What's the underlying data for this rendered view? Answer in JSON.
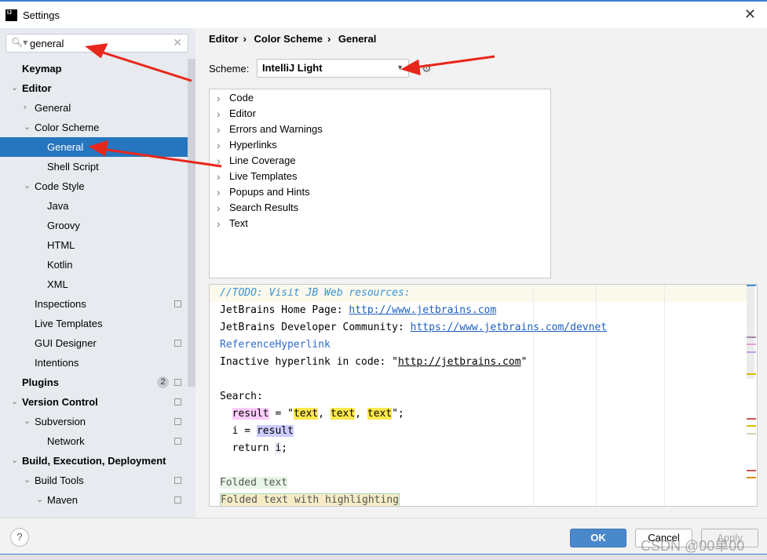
{
  "window": {
    "title": "Settings",
    "logo": "IJ"
  },
  "search": {
    "value": "general"
  },
  "sidebar": {
    "items": [
      {
        "label": "Keymap",
        "level": 0,
        "bold": true,
        "arrow": ""
      },
      {
        "label": "Editor",
        "level": 0,
        "bold": true,
        "arrow": "down"
      },
      {
        "label": "General",
        "level": 1,
        "arrow": "right"
      },
      {
        "label": "Color Scheme",
        "level": 1,
        "arrow": "down"
      },
      {
        "label": "General",
        "level": 2,
        "arrow": "",
        "selected": true
      },
      {
        "label": "Shell Script",
        "level": 2,
        "arrow": ""
      },
      {
        "label": "Code Style",
        "level": 1,
        "arrow": "down"
      },
      {
        "label": "Java",
        "level": 2,
        "arrow": ""
      },
      {
        "label": "Groovy",
        "level": 2,
        "arrow": ""
      },
      {
        "label": "HTML",
        "level": 2,
        "arrow": ""
      },
      {
        "label": "Kotlin",
        "level": 2,
        "arrow": ""
      },
      {
        "label": "XML",
        "level": 2,
        "arrow": ""
      },
      {
        "label": "Inspections",
        "level": 1,
        "arrow": "",
        "page": true
      },
      {
        "label": "Live Templates",
        "level": 1,
        "arrow": ""
      },
      {
        "label": "GUI Designer",
        "level": 1,
        "arrow": "",
        "page": true
      },
      {
        "label": "Intentions",
        "level": 1,
        "arrow": ""
      },
      {
        "label": "Plugins",
        "level": 0,
        "bold": true,
        "arrow": "",
        "badge": "2",
        "page": true
      },
      {
        "label": "Version Control",
        "level": 0,
        "bold": true,
        "arrow": "down",
        "page": true
      },
      {
        "label": "Subversion",
        "level": 1,
        "arrow": "down",
        "page": true
      },
      {
        "label": "Network",
        "level": 2,
        "arrow": "",
        "page": true
      },
      {
        "label": "Build, Execution, Deployment",
        "level": 0,
        "bold": true,
        "arrow": "down"
      },
      {
        "label": "Build Tools",
        "level": 1,
        "arrow": "down",
        "page": true
      },
      {
        "label": "Maven",
        "level": 1.5,
        "arrow": "down",
        "page": true
      }
    ]
  },
  "breadcrumb": [
    "Editor",
    "Color Scheme",
    "General"
  ],
  "scheme": {
    "label": "Scheme:",
    "value": "IntelliJ Light"
  },
  "categories": [
    "Code",
    "Editor",
    "Errors and Warnings",
    "Hyperlinks",
    "Line Coverage",
    "Live Templates",
    "Popups and Hints",
    "Search Results",
    "Text"
  ],
  "preview": {
    "todo": "//TODO: Visit JB Web resources:",
    "home_label": "JetBrains Home Page: ",
    "home_link": "http://www.jetbrains.com",
    "dev_label": "JetBrains Developer Community: ",
    "dev_link": "https://www.jetbrains.com/devnet",
    "ref": "ReferenceHyperlink",
    "inactive_label": "Inactive hyperlink in code: ",
    "inactive_link": "http://jetbrains.com",
    "search": "Search:",
    "result": "result",
    "text": "text",
    "i": "i",
    "return": "return",
    "folded": "Folded text",
    "folded_hl": "Folded text with highlighting"
  },
  "footer": {
    "ok": "OK",
    "cancel": "Cancel",
    "apply": "Apply",
    "help": "?"
  },
  "watermark": "CSDN @00单00",
  "colors": {
    "selection": "#2675bf",
    "ok": "#4a88cc",
    "annotation_arrow": "#e8271c"
  }
}
